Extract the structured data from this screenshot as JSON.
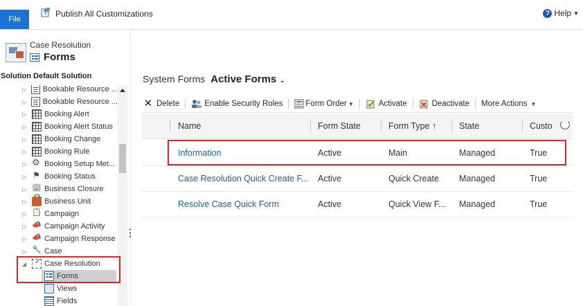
{
  "topbar": {
    "file_label": "File",
    "publish_label": "Publish All Customizations",
    "help_label": "Help"
  },
  "sidebar": {
    "entity_name": "Case Resolution",
    "section_title": "Forms",
    "solution_label": "Solution Default Solution",
    "tree_items": [
      {
        "label": "Bookable Resource ...",
        "icon": "document-icon"
      },
      {
        "label": "Bookable Resource ...",
        "icon": "document-icon"
      },
      {
        "label": "Booking Alert",
        "icon": "grid-icon"
      },
      {
        "label": "Booking Alert Status",
        "icon": "grid-icon"
      },
      {
        "label": "Booking Change",
        "icon": "grid-icon"
      },
      {
        "label": "Booking Rule",
        "icon": "grid-icon"
      },
      {
        "label": "Booking Setup Met...",
        "icon": "gear-icon"
      },
      {
        "label": "Booking Status",
        "icon": "flag-icon"
      },
      {
        "label": "Business Closure",
        "icon": "building-icon"
      },
      {
        "label": "Business Unit",
        "icon": "briefcase-icon"
      },
      {
        "label": "Campaign",
        "icon": "campaign-icon"
      },
      {
        "label": "Campaign Activity",
        "icon": "megaphone-icon"
      },
      {
        "label": "Campaign Response",
        "icon": "megaphone-icon"
      },
      {
        "label": "Case",
        "icon": "wrench-icon"
      },
      {
        "label": "Case Resolution",
        "icon": "case-resolution-icon"
      }
    ],
    "sub_items": [
      {
        "label": "Forms",
        "icon": "form-icon"
      },
      {
        "label": "Views",
        "icon": "views-icon"
      },
      {
        "label": "Fields",
        "icon": "fields-icon"
      }
    ]
  },
  "main": {
    "breadcrumb_system": "System Forms",
    "view_selector": "Active Forms",
    "toolbar": {
      "delete": "Delete",
      "enable_security_roles": "Enable Security Roles",
      "form_order": "Form Order",
      "activate": "Activate",
      "deactivate": "Deactivate",
      "more_actions": "More Actions"
    },
    "columns": [
      "Name",
      "Form State",
      "Form Type ↑",
      "State",
      "Custo"
    ],
    "rows": [
      [
        "Information",
        "Active",
        "Main",
        "Managed",
        "True"
      ],
      [
        "Case Resolution Quick Create F...",
        "Active",
        "Quick Create",
        "Managed",
        "True"
      ],
      [
        "Resolve Case Quick Form",
        "Active",
        "Quick View F...",
        "Managed",
        "True"
      ]
    ]
  },
  "colors": {
    "accent": "#1c73d6",
    "highlight": "#d9262a",
    "link": "#1f5ea8"
  }
}
